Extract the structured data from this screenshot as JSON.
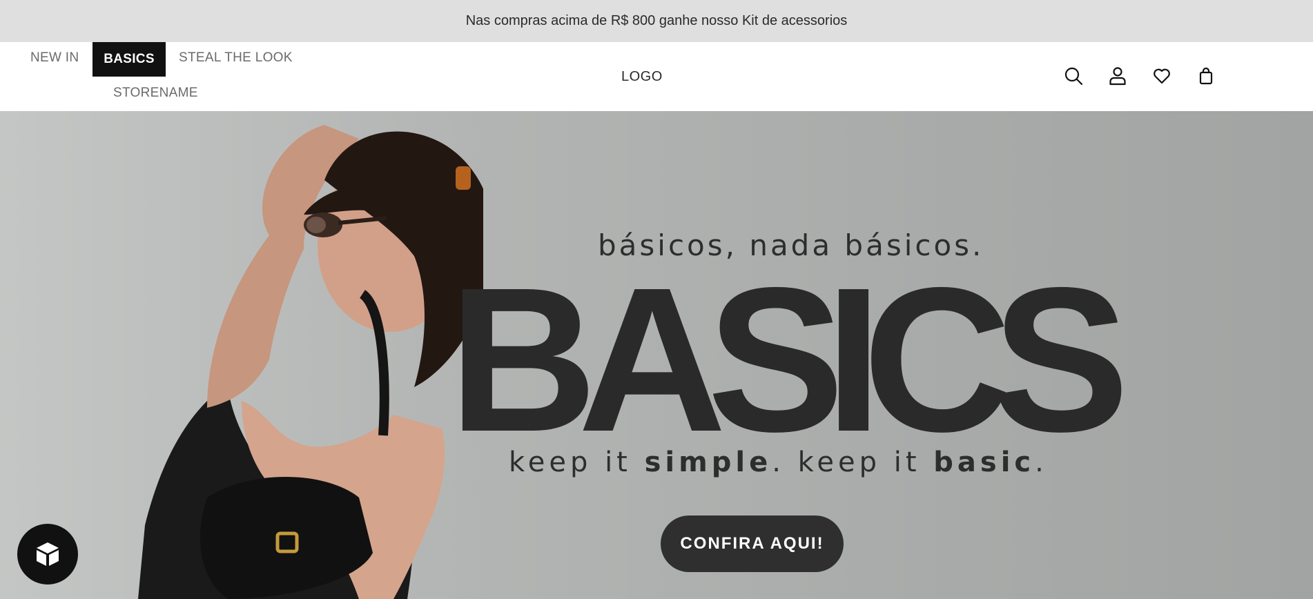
{
  "announcement": {
    "text": "Nas compras acima de R$ 800 ganhe nosso Kit de acessorios"
  },
  "nav": {
    "items": [
      {
        "label": "NEW IN",
        "active": false
      },
      {
        "label": "BASICS",
        "active": true
      },
      {
        "label": "STEAL THE LOOK",
        "active": false
      },
      {
        "label": "STORENAME",
        "active": false
      }
    ]
  },
  "logo": {
    "text": "LOGO"
  },
  "header_icons": [
    "search-icon",
    "user-icon",
    "heart-icon",
    "bag-icon"
  ],
  "hero": {
    "tagline": "básicos, nada básicos.",
    "headline": "BASICS",
    "subline_parts": [
      "keep it ",
      "simple",
      ". keep it ",
      "basic",
      "."
    ],
    "cta_label": "CONFIRA AQUI!"
  },
  "widget": {
    "icon": "cube-icon"
  },
  "colors": {
    "topbar_bg": "#e0dfe0",
    "nav_active_bg": "#111111",
    "hero_text": "#2a2a2a",
    "cta_bg": "#2f2f2f"
  }
}
